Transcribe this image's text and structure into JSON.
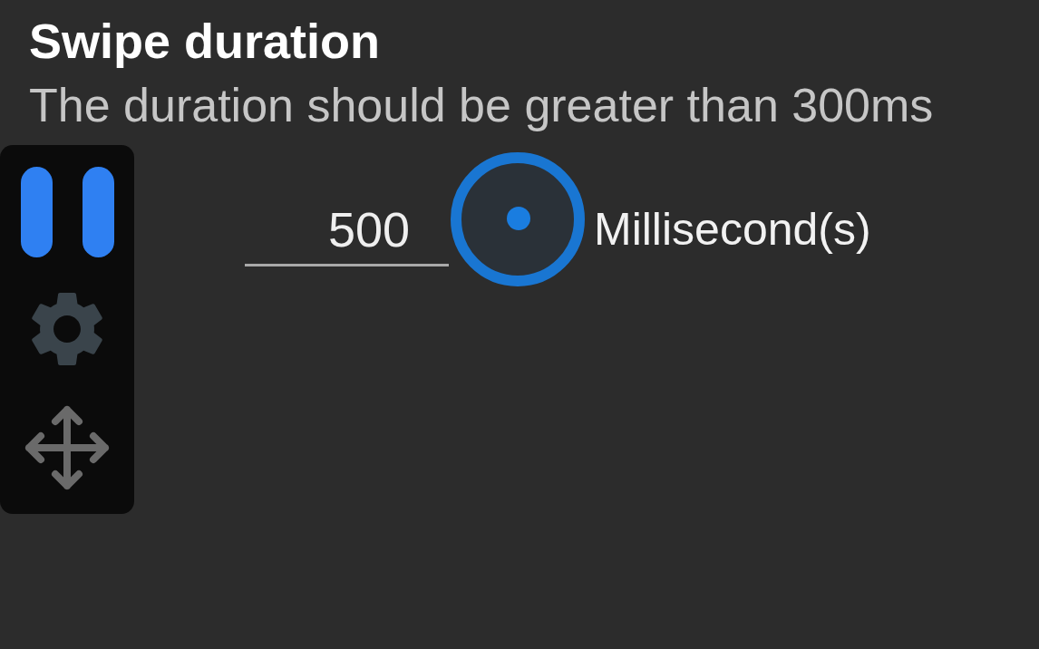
{
  "setting": {
    "title": "Swipe duration",
    "description": "The duration should be greater than 300ms",
    "value": "500",
    "unit": "Millisecond(s)"
  }
}
